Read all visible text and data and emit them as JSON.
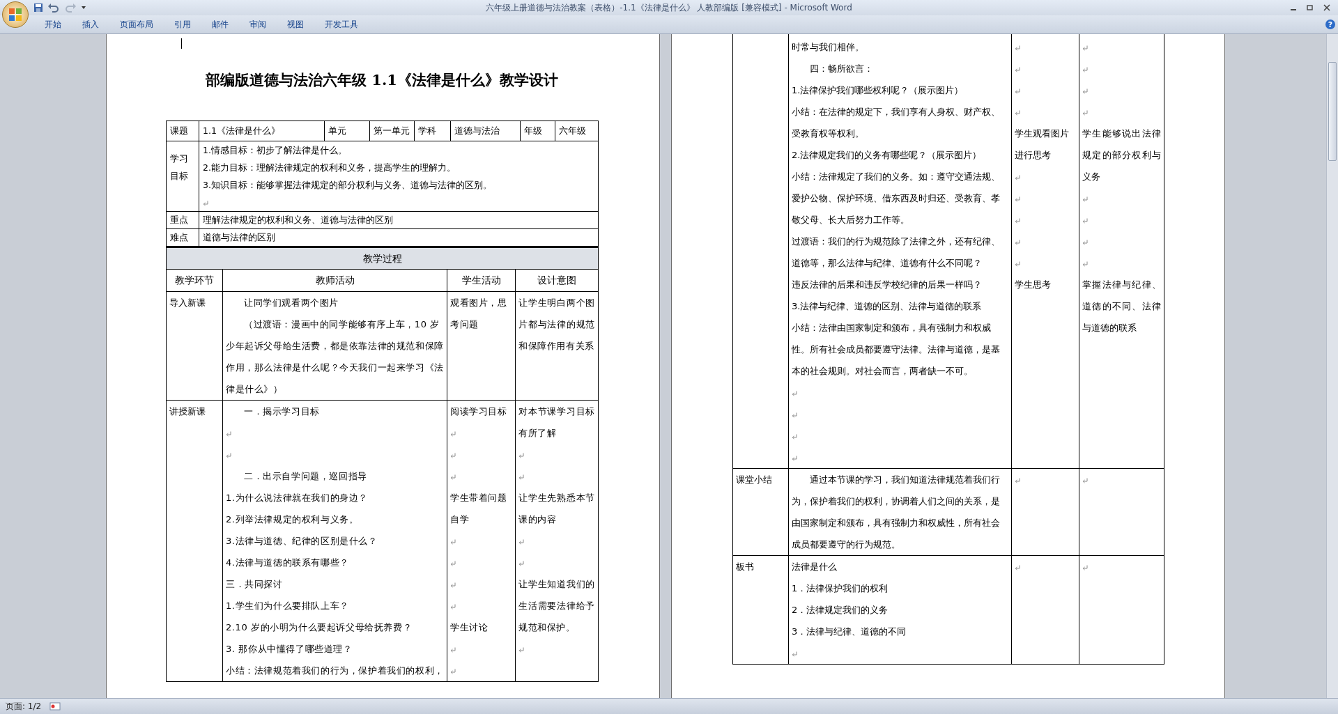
{
  "window": {
    "title": "六年级上册道德与法治教案（表格）-1.1《法律是什么》 人教部编版 [兼容模式] - Microsoft Word"
  },
  "ribbon_tabs": [
    "开始",
    "插入",
    "页面布局",
    "引用",
    "邮件",
    "审阅",
    "视图",
    "开发工具"
  ],
  "help_button": "?",
  "left_page": {
    "heading": "部编版道德与法治六年级 1.1《法律是什么》教学设计",
    "info_table": {
      "header_row": [
        "课题",
        "1.1《法律是什么》",
        "单元",
        "第一单元",
        "学科",
        "道德与法治",
        "年级",
        "六年级"
      ],
      "objectives": {
        "label": "学习目标",
        "lines": [
          "1.情感目标：初步了解法律是什么。",
          "2.能力目标：理解法律规定的权利和义务，提高学生的理解力。",
          "3.知识目标：能够掌握法律规定的部分权利与义务、道德与法律的区别。",
          {
            "kind": "blank"
          }
        ]
      },
      "key_point": {
        "label": "重点",
        "text": "理解法律规定的权利和义务、道德与法律的区别"
      },
      "difficulty": {
        "label": "难点",
        "text": "道德与法律的区别"
      }
    },
    "process_table": {
      "title": "教学过程",
      "columns": [
        "教学环节",
        "教师活动",
        "学生活动",
        "设计意图"
      ],
      "rows": [
        {
          "stage": "导入新课",
          "teacher": [
            {
              "text": "让同学们观看两个图片",
              "indent": true
            },
            {
              "text": "（过渡语：漫画中的同学能够有序上车，10 岁少年起诉父母给生活费，都是依靠法律的规范和保障作用，那么法律是什么呢？今天我们一起来学习《法律是什么》）",
              "indent": true
            }
          ],
          "student": [
            "观看图片，思考问题"
          ],
          "intent": [
            "让学生明白两个图片都与法律的规范和保障作用有关系"
          ]
        },
        {
          "stage": "讲授新课",
          "teacher": [
            {
              "text": "一．揭示学习目标",
              "indent": true
            },
            {
              "kind": "blank"
            },
            {
              "kind": "blank"
            },
            {
              "text": "二．出示自学问题，巡回指导",
              "indent": true
            },
            "1.为什么说法律就在我们的身边？",
            "2.列举法律规定的权利与义务。",
            "3.法律与道德、纪律的区别是什么？",
            "4.法律与道德的联系有哪些？",
            "三．共同探讨",
            "1.学生们为什么要排队上车？",
            "2.10 岁的小明为什么要起诉父母给抚养费？",
            "3.  那你从中懂得了哪些道理？",
            "小结：法律规范着我们的行为，保护着我们的权利，"
          ],
          "student": [
            "阅读学习目标",
            {
              "kind": "blank"
            },
            {
              "kind": "blank"
            },
            {
              "kind": "blank"
            },
            "学生带着问题自学",
            {
              "kind": "blank"
            },
            {
              "kind": "blank"
            },
            {
              "kind": "blank"
            },
            {
              "kind": "blank"
            },
            "学生讨论",
            {
              "kind": "blank"
            },
            {
              "kind": "blank"
            }
          ],
          "intent": [
            "对本节课学习目标有所了解",
            {
              "kind": "blank"
            },
            {
              "kind": "blank"
            },
            "让学生先熟悉本节课的内容",
            {
              "kind": "blank"
            },
            {
              "kind": "blank"
            },
            "让学生知道我们的生活需要法律给予规范和保护。",
            {
              "kind": "blank"
            }
          ]
        }
      ]
    }
  },
  "right_page": {
    "process_table": {
      "rows": [
        {
          "teacher": [
            "时常与我们相伴。",
            {
              "text": "四：畅所欲言：",
              "indent": true
            },
            "1.法律保护我们哪些权利呢？（展示图片）",
            "小结：在法律的规定下，我们享有人身权、财产权、受教育权等权利。",
            "2.法律规定我们的义务有哪些呢？（展示图片）",
            "小结：法律规定了我们的义务。如：遵守交通法规、爱护公物、保护环境、借东西及时归还、受教育、孝敬父母、长大后努力工作等。",
            "过渡语：我们的行为规范除了法律之外，还有纪律、道德等，那么法律与纪律、道德有什么不同呢？",
            "违反法律的后果和违反学校纪律的后果一样吗？",
            "3.法律与纪律、道德的区别、法律与道德的联系",
            "小结：法律由国家制定和颁布，具有强制力和权威性。所有社会成员都要遵守法律。法律与道德，是基本的社会规则。对社会而言，两者缺一不可。",
            {
              "kind": "blank"
            },
            {
              "kind": "blank"
            },
            {
              "kind": "blank"
            },
            {
              "kind": "blank"
            }
          ],
          "student": [
            {
              "kind": "blank"
            },
            {
              "kind": "blank"
            },
            {
              "kind": "blank"
            },
            {
              "kind": "blank"
            },
            "学生观看图片进行思考",
            {
              "kind": "blank"
            },
            {
              "kind": "blank"
            },
            {
              "kind": "blank"
            },
            {
              "kind": "blank"
            },
            {
              "kind": "blank"
            },
            "学生思考"
          ],
          "intent": [
            {
              "kind": "blank"
            },
            {
              "kind": "blank"
            },
            {
              "kind": "blank"
            },
            {
              "kind": "blank"
            },
            "学生能够说出法律规定的部分权利与义务",
            {
              "kind": "blank"
            },
            {
              "kind": "blank"
            },
            {
              "kind": "blank"
            },
            {
              "kind": "blank"
            },
            "掌握法律与纪律、道德的不同、法律与道德的联系"
          ]
        },
        {
          "stage": "课堂小结",
          "teacher": [
            {
              "text": "通过本节课的学习，我们知道法律规范着我们行为，保护着我们的权利，协调着人们之间的关系，是由国家制定和颁布，具有强制力和权威性，所有社会成员都要遵守的行为规范。",
              "indent": true
            }
          ],
          "student": [
            {
              "kind": "blank"
            }
          ],
          "intent": [
            {
              "kind": "blank"
            }
          ]
        },
        {
          "stage": "板书",
          "teacher": [
            "法律是什么",
            "1．法律保护我们的权利",
            "2．法律规定我们的义务",
            "3．法律与纪律、道德的不同",
            {
              "kind": "blank"
            }
          ],
          "student": [
            {
              "kind": "blank"
            }
          ],
          "intent": [
            {
              "kind": "blank"
            }
          ]
        }
      ]
    }
  },
  "status_bar": {
    "page": "页面: 1/2"
  }
}
